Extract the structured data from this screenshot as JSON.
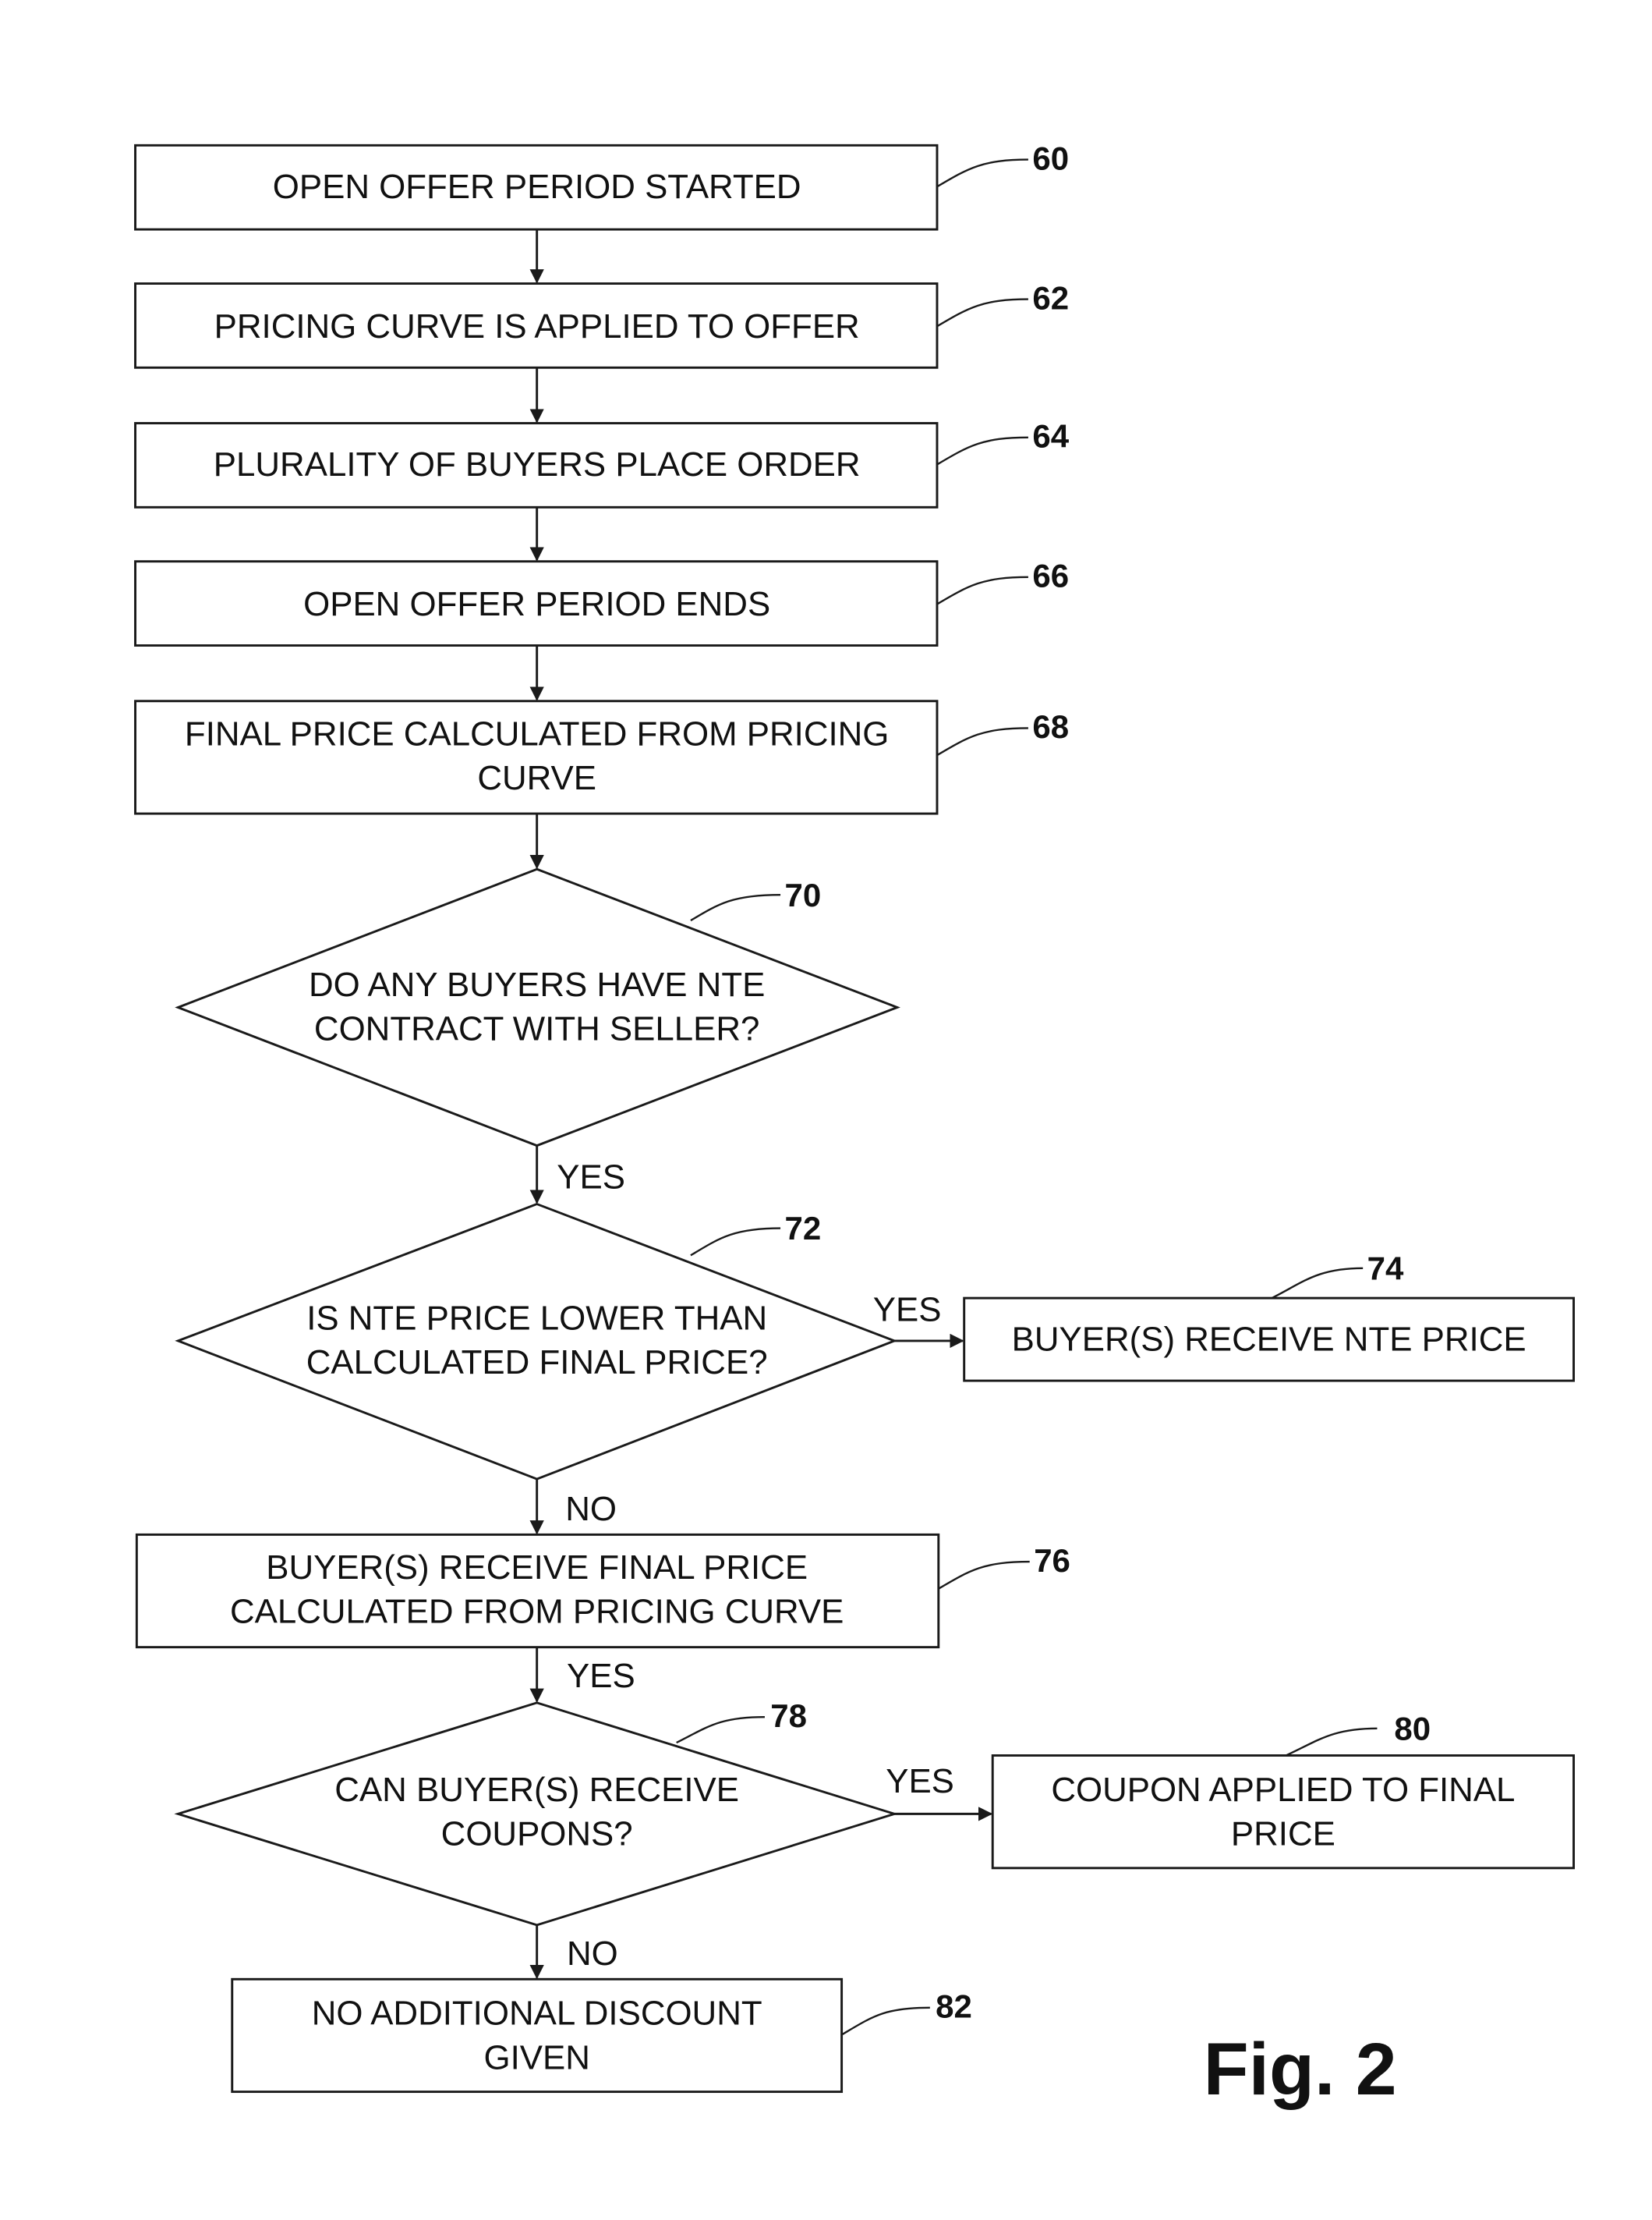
{
  "figure": {
    "title": "Fig. 2"
  },
  "nodes": {
    "n60": {
      "ref": "60",
      "type": "process",
      "lines": [
        "OPEN OFFER PERIOD STARTED"
      ]
    },
    "n62": {
      "ref": "62",
      "type": "process",
      "lines": [
        "PRICING CURVE IS APPLIED TO OFFER"
      ]
    },
    "n64": {
      "ref": "64",
      "type": "process",
      "lines": [
        "PLURALITY OF BUYERS PLACE ORDER"
      ]
    },
    "n66": {
      "ref": "66",
      "type": "process",
      "lines": [
        "OPEN OFFER PERIOD ENDS"
      ]
    },
    "n68": {
      "ref": "68",
      "type": "process",
      "lines": [
        "FINAL PRICE CALCULATED FROM PRICING",
        "CURVE"
      ]
    },
    "n70": {
      "ref": "70",
      "type": "decision",
      "lines": [
        "DO ANY BUYERS HAVE NTE",
        "CONTRACT WITH SELLER?"
      ]
    },
    "n72": {
      "ref": "72",
      "type": "decision",
      "lines": [
        "IS NTE PRICE LOWER THAN",
        "CALCULATED FINAL PRICE?"
      ]
    },
    "n74": {
      "ref": "74",
      "type": "process",
      "lines": [
        "BUYER(S) RECEIVE NTE PRICE"
      ]
    },
    "n76": {
      "ref": "76",
      "type": "process",
      "lines": [
        "BUYER(S) RECEIVE FINAL PRICE",
        "CALCULATED FROM PRICING CURVE"
      ]
    },
    "n78": {
      "ref": "78",
      "type": "decision",
      "lines": [
        "CAN BUYER(S) RECEIVE",
        "COUPONS?"
      ]
    },
    "n80": {
      "ref": "80",
      "type": "process",
      "lines": [
        "COUPON APPLIED TO FINAL",
        "PRICE"
      ]
    },
    "n82": {
      "ref": "82",
      "type": "process",
      "lines": [
        "NO ADDITIONAL DISCOUNT",
        "GIVEN"
      ]
    }
  },
  "edges": {
    "e60_62": {
      "from": "60",
      "to": "62",
      "label": ""
    },
    "e62_64": {
      "from": "62",
      "to": "64",
      "label": ""
    },
    "e64_66": {
      "from": "64",
      "to": "66",
      "label": ""
    },
    "e66_68": {
      "from": "66",
      "to": "68",
      "label": ""
    },
    "e68_70": {
      "from": "68",
      "to": "70",
      "label": ""
    },
    "e70_72": {
      "from": "70",
      "to": "72",
      "label": "YES"
    },
    "e72_74": {
      "from": "72",
      "to": "74",
      "label": "YES"
    },
    "e72_76": {
      "from": "72",
      "to": "76",
      "label": "NO"
    },
    "e76_78": {
      "from": "76",
      "to": "78",
      "label": "YES"
    },
    "e78_80": {
      "from": "78",
      "to": "80",
      "label": "YES"
    },
    "e78_82": {
      "from": "78",
      "to": "82",
      "label": "NO"
    }
  }
}
